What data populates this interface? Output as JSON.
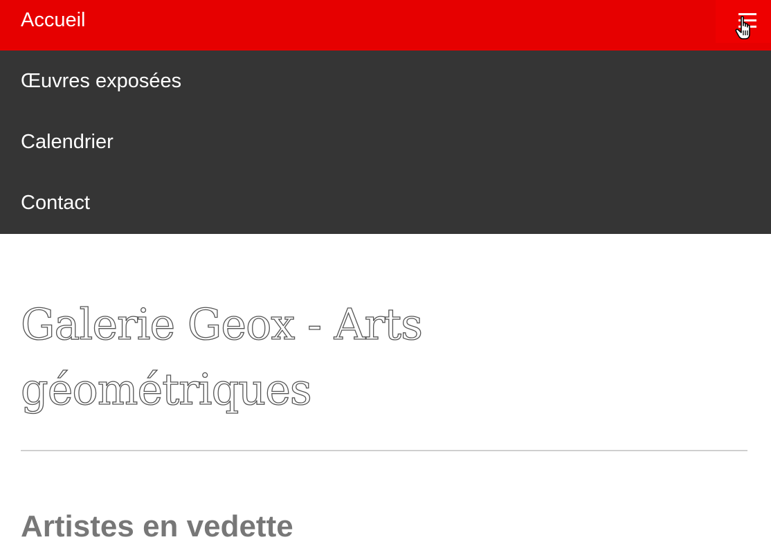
{
  "header": {
    "home_label": "Accueil",
    "menu_toggle_icon": "hamburger-menu-icon",
    "cursor_icon": "hand-pointer-cursor",
    "bar_color": "#e60000"
  },
  "nav": {
    "background_color": "#353535",
    "items": [
      {
        "label": "Œuvres exposées"
      },
      {
        "label": "Calendrier"
      },
      {
        "label": "Contact"
      }
    ]
  },
  "main": {
    "title": "Galerie Geox - Arts géométriques",
    "section_heading": "Artistes en vedette"
  }
}
